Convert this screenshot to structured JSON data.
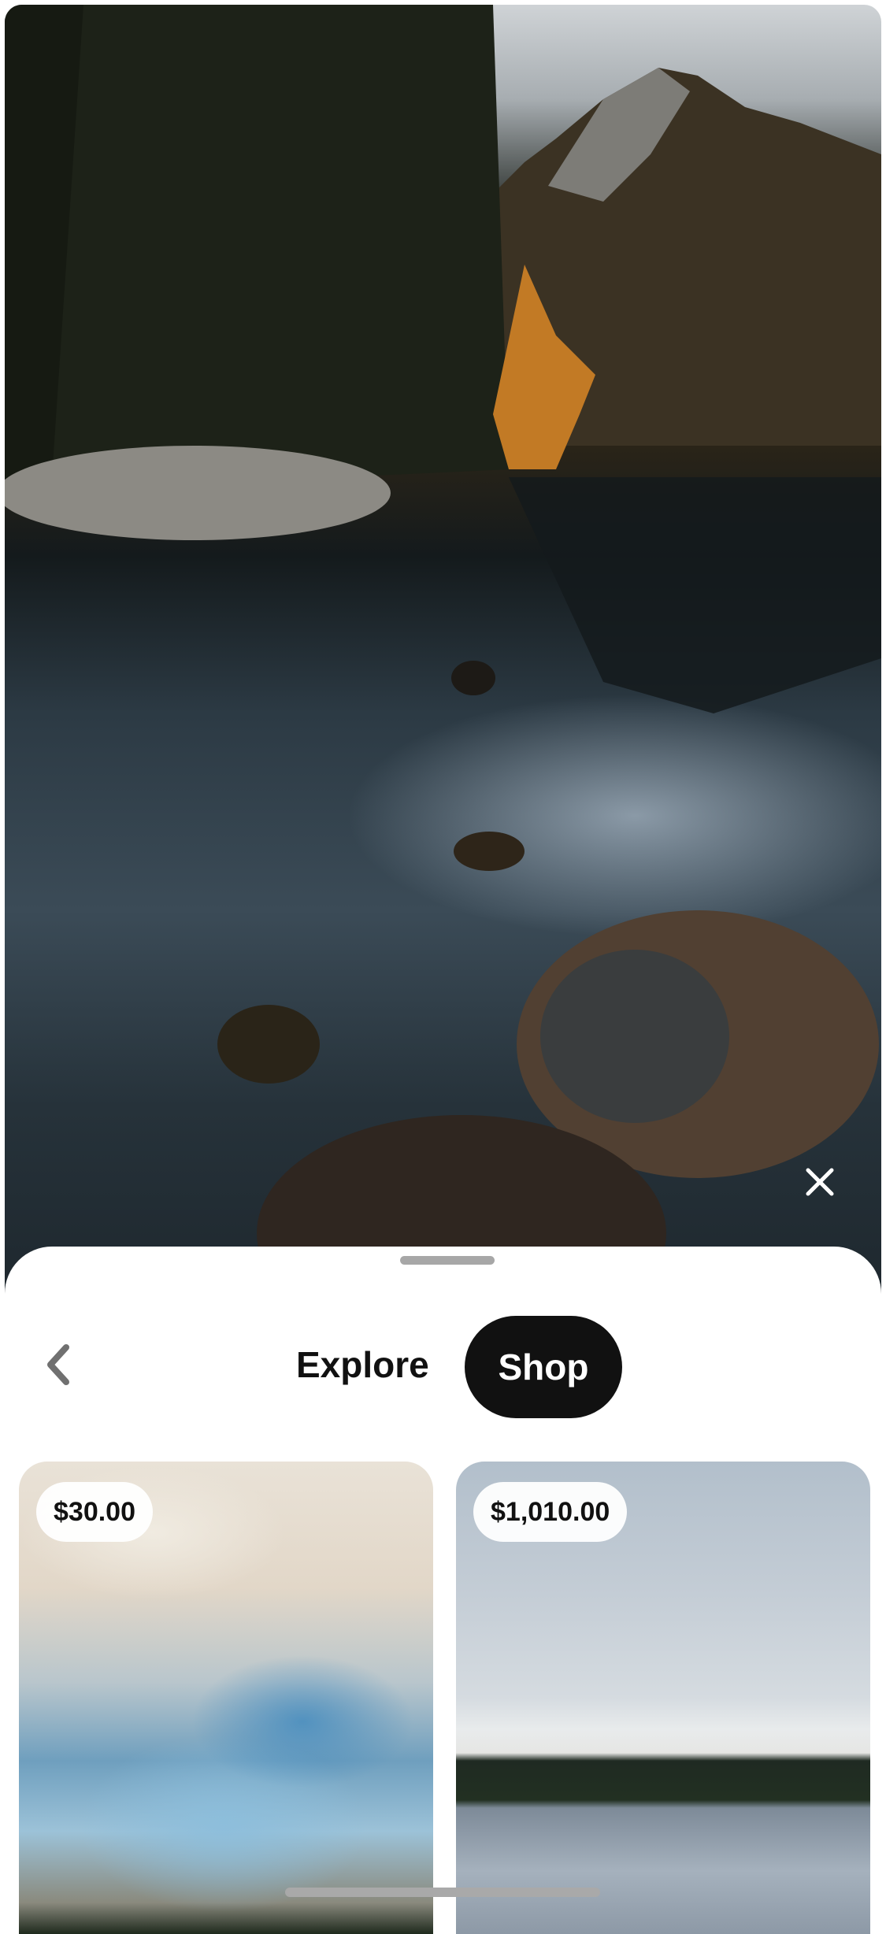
{
  "hero": {
    "close_icon": "close-icon"
  },
  "sheet": {
    "back_icon": "chevron-left-icon",
    "tabs": [
      {
        "label": "Explore",
        "selected": false
      },
      {
        "label": "Shop",
        "selected": true
      }
    ],
    "products": [
      {
        "price": "$30.00"
      },
      {
        "price": "$1,010.00"
      }
    ]
  },
  "colors": {
    "selected_tab_bg": "#111111",
    "selected_tab_text": "#ffffff",
    "text": "#111111"
  }
}
